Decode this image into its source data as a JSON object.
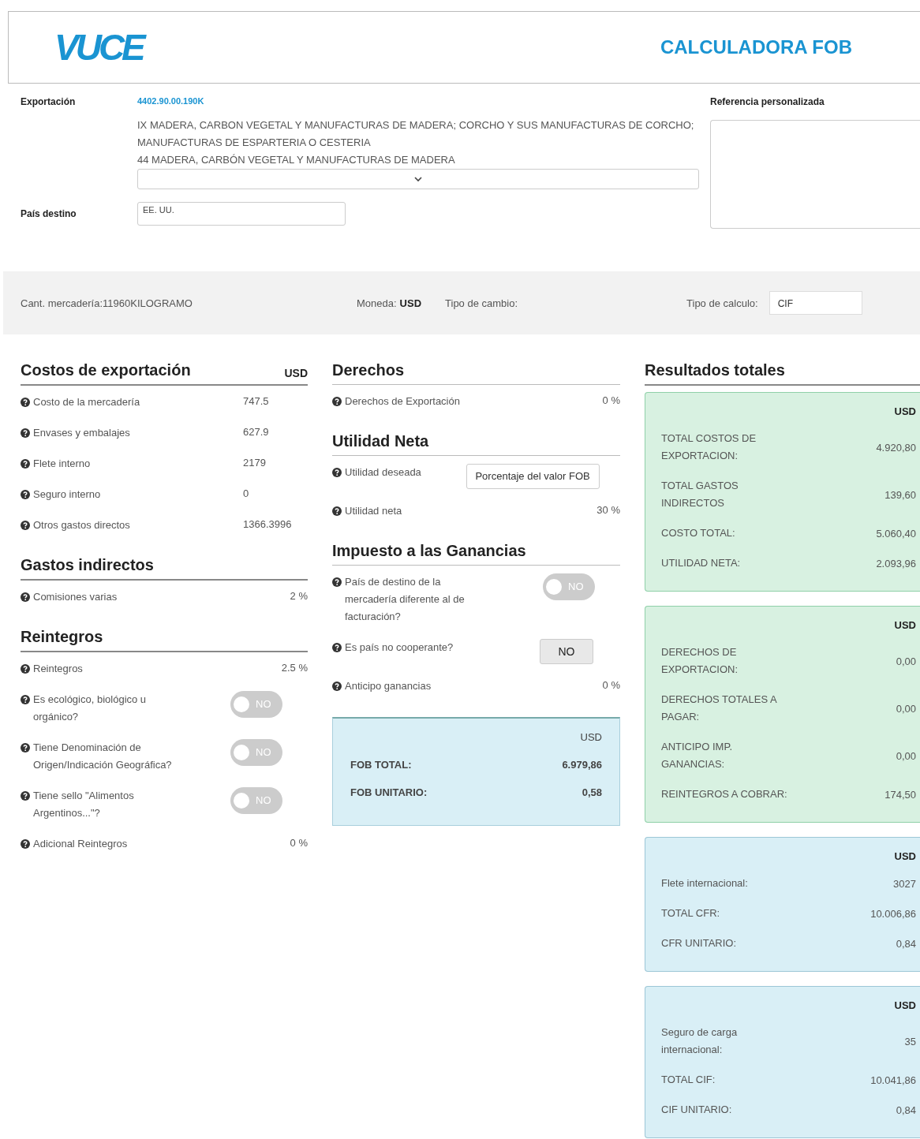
{
  "header": {
    "logo": "VUCE",
    "title": "CALCULADORA FOB"
  },
  "export": {
    "label": "Exportación",
    "code": "4402.90.00.190K",
    "description": [
      "IX MADERA, CARBON VEGETAL Y MANUFACTURAS DE MADERA; CORCHO Y SUS MANUFACTURAS DE CORCHO; MANUFACTURAS DE ESPARTERIA O CESTERIA",
      "44 MADERA, CARBÓN VEGETAL Y MANUFACTURAS DE MADERA"
    ]
  },
  "destination": {
    "label": "País destino",
    "value": "EE. UU."
  },
  "reference": {
    "label": "Referencia personalizada"
  },
  "summary_bar": {
    "quantity": "Cant. mercadería:11960KILOGRAMO",
    "currency_label": "Moneda:",
    "currency": "USD",
    "exchange_label": "Tipo de cambio:",
    "calc_label": "Tipo de calculo:",
    "calc_value": "CIF"
  },
  "left_sections": [
    {
      "title": "Costos de exportación",
      "unit": "USD",
      "rows": [
        {
          "kind": "value",
          "label": "Costo de la mercadería",
          "value": "747.5"
        },
        {
          "kind": "value",
          "label": "Envases y embalajes",
          "value": "627.9"
        },
        {
          "kind": "value",
          "label": "Flete interno",
          "value": "2179"
        },
        {
          "kind": "value",
          "label": "Seguro interno",
          "value": "0"
        },
        {
          "kind": "value",
          "label": "Otros gastos directos",
          "value": "1366.3996"
        }
      ]
    },
    {
      "title": "Gastos indirectos",
      "rows": [
        {
          "kind": "value",
          "label": "Comisiones varias",
          "value": "2 %"
        }
      ]
    },
    {
      "title": "Reintegros",
      "rows": [
        {
          "kind": "value",
          "label": "Reintegros",
          "value": "2.5 %"
        },
        {
          "kind": "toggle",
          "label": "Es ecológico, biológico u orgánico?",
          "value": "NO",
          "on": false
        },
        {
          "kind": "toggle",
          "label": "Tiene Denominación de Origen/Indicación Geográfica?",
          "value": "NO",
          "on": false
        },
        {
          "kind": "toggle",
          "label": "Tiene sello \"Alimentos Argentinos...\"?",
          "value": "NO",
          "on": false
        },
        {
          "kind": "value",
          "label": "Adicional Reintegros",
          "value": "0 %"
        }
      ]
    }
  ],
  "middle_sections": [
    {
      "title": "Derechos",
      "rows": [
        {
          "kind": "value",
          "label": "Derechos de Exportación",
          "value": "0 %"
        }
      ]
    },
    {
      "title": "Utilidad Neta",
      "rows": [
        {
          "kind": "select",
          "label": "Utilidad deseada",
          "value": "Porcentaje del valor FOB"
        },
        {
          "kind": "value",
          "label": "Utilidad neta",
          "value": "30 %"
        }
      ]
    },
    {
      "title": "Impuesto a las Ganancias",
      "rows": [
        {
          "kind": "toggle",
          "label": "País de destino de la mercadería diferente al de facturación?",
          "value": "NO",
          "on": false
        },
        {
          "kind": "button",
          "label": "Es país no cooperante?",
          "value": "NO"
        },
        {
          "kind": "value",
          "label": "Anticipo ganancias",
          "value": "0 %"
        }
      ]
    }
  ],
  "fob_box": {
    "unit": "USD",
    "rows": [
      {
        "label": "FOB TOTAL:",
        "value": "6.979,86"
      },
      {
        "label": "FOB UNITARIO:",
        "value": "0,58"
      }
    ]
  },
  "results": {
    "title": "Resultados totales",
    "cards": [
      {
        "color": "#d8f1e1",
        "unit": "USD",
        "rows": [
          {
            "label": "TOTAL COSTOS DE EXPORTACION:",
            "value": "4.920,80"
          },
          {
            "label": "TOTAL GASTOS INDIRECTOS",
            "value": "139,60"
          },
          {
            "label": "COSTO TOTAL:",
            "value": "5.060,40"
          },
          {
            "label": "UTILIDAD NETA:",
            "value": "2.093,96"
          }
        ]
      },
      {
        "color": "#d8f1e1",
        "unit": "USD",
        "rows": [
          {
            "label": "DERECHOS DE EXPORTACION:",
            "value": "0,00"
          },
          {
            "label": "DERECHOS TOTALES A PAGAR:",
            "value": "0,00"
          },
          {
            "label": "ANTICIPO IMP. GANANCIAS:",
            "value": "0,00"
          },
          {
            "label": "REINTEGROS A COBRAR:",
            "value": "174,50"
          }
        ]
      },
      {
        "color": "#d9eff6",
        "unit": "USD",
        "rows": [
          {
            "label": "Flete internacional:",
            "value": "3027"
          },
          {
            "label": "TOTAL CFR:",
            "value": "10.006,86"
          },
          {
            "label": "CFR UNITARIO:",
            "value": "0,84"
          }
        ]
      },
      {
        "color": "#d9eff6",
        "unit": "USD",
        "rows": [
          {
            "label": "Seguro de carga internacional:",
            "value": "35"
          },
          {
            "label": "TOTAL CIF:",
            "value": "10.041,86"
          },
          {
            "label": "CIF UNITARIO:",
            "value": "0,84"
          }
        ]
      }
    ]
  }
}
